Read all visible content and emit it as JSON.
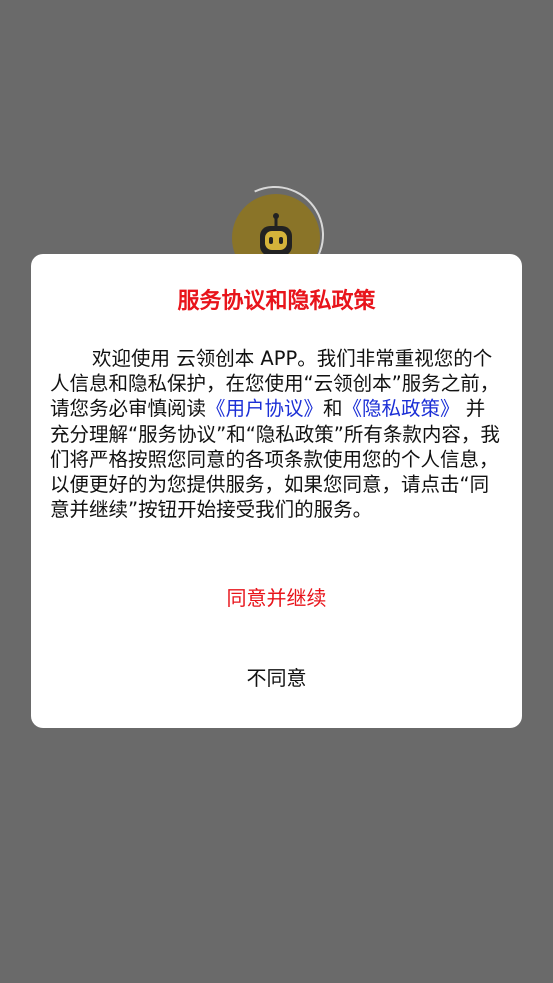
{
  "dialog": {
    "title": "服务协议和隐私政策",
    "body_part1": "欢迎使用 云领创本 APP。我们非常重视您的个人信息和隐私保护，在您使用“云领创本”服务之前，请您务必审慎阅读",
    "user_agreement_link": "《用户协议》",
    "body_and": "和",
    "privacy_policy_link": "《隐私政策》",
    "body_part2": " 并充分理解“服务协议”和“隐私政策”所有条款内容，我们将严格按照您同意的各项条款使用您的个人信息，以便更好的为您提供服务，如果您同意，请点击“同意并继续”按钮开始接受我们的服务。",
    "agree_label": "同意并继续",
    "disagree_label": "不同意"
  },
  "splash": {
    "logo_icon": "robot-icon"
  },
  "colors": {
    "overlay": "#6a6a6a",
    "accent_red": "#e8141b",
    "link_blue": "#1b2fd6",
    "logo_gold": "#8a7428"
  }
}
